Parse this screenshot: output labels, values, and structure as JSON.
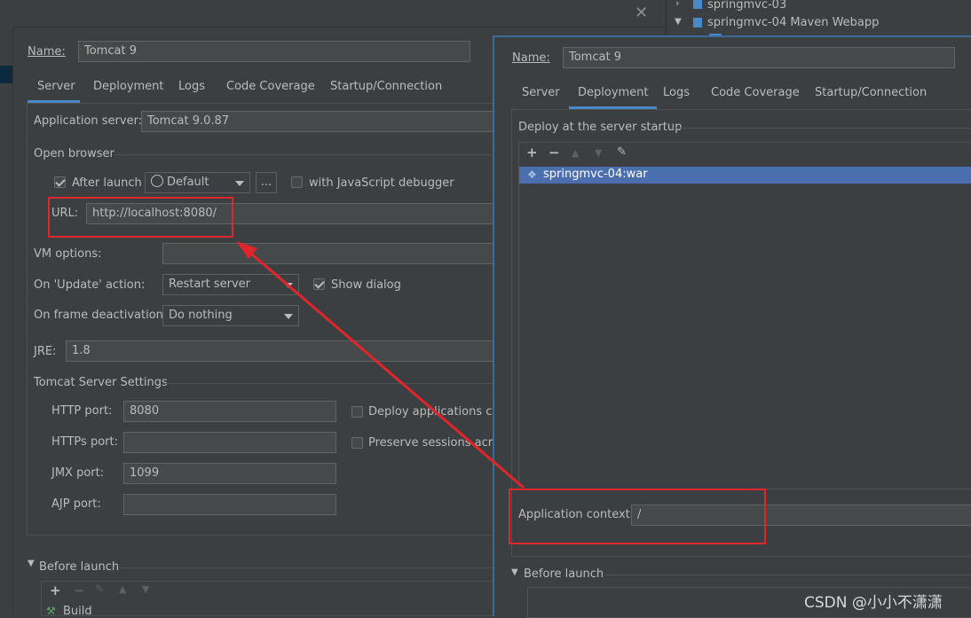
{
  "project_tree": {
    "items": [
      {
        "label": "springmvc-03"
      },
      {
        "label": "springmvc-04 Maven Webapp"
      }
    ]
  },
  "left_dialog": {
    "name_label": "Name:",
    "name_value": "Tomcat 9",
    "tabs": [
      "Server",
      "Deployment",
      "Logs",
      "Code Coverage",
      "Startup/Connection"
    ],
    "app_server_label": "Application server:",
    "app_server_value": "Tomcat 9.0.87",
    "open_browser_label": "Open browser",
    "after_launch_label": "After launch",
    "browser_value": "Default",
    "browse_button": "...",
    "js_debugger_label": "with JavaScript debugger",
    "url_label": "URL:",
    "url_value": "http://localhost:8080/",
    "vm_options_label": "VM options:",
    "on_update_label": "On 'Update' action:",
    "on_update_value": "Restart server",
    "show_dialog_label": "Show dialog",
    "on_frame_label": "On frame deactivation:",
    "on_frame_value": "Do nothing",
    "jre_label": "JRE:",
    "jre_value": "1.8",
    "tomcat_settings_label": "Tomcat Server Settings",
    "http_port_label": "HTTP port:",
    "http_port_value": "8080",
    "https_port_label": "HTTPs port:",
    "https_port_value": "",
    "jmx_port_label": "JMX port:",
    "jmx_port_value": "1099",
    "ajp_port_label": "AJP port:",
    "ajp_port_value": "",
    "deploy_apps_label": "Deploy applications con",
    "preserve_sessions_label": "Preserve sessions across",
    "before_launch_label": "Before launch",
    "build_label": "Build"
  },
  "right_dialog": {
    "name_label": "Name:",
    "name_value": "Tomcat 9",
    "tabs": [
      "Server",
      "Deployment",
      "Logs",
      "Code Coverage",
      "Startup/Connection"
    ],
    "active_tab": "Deployment",
    "deploy_label": "Deploy at the server startup",
    "artifacts": [
      "springmvc-04:war"
    ],
    "app_context_label": "Application context:",
    "app_context_value": "/",
    "before_launch_label": "Before launch"
  },
  "watermark": "CSDN @小小不潇潇",
  "colors": {
    "accent": "#4a88c7",
    "annotation_red": "#e0262b",
    "selection": "#4b6eaf"
  }
}
